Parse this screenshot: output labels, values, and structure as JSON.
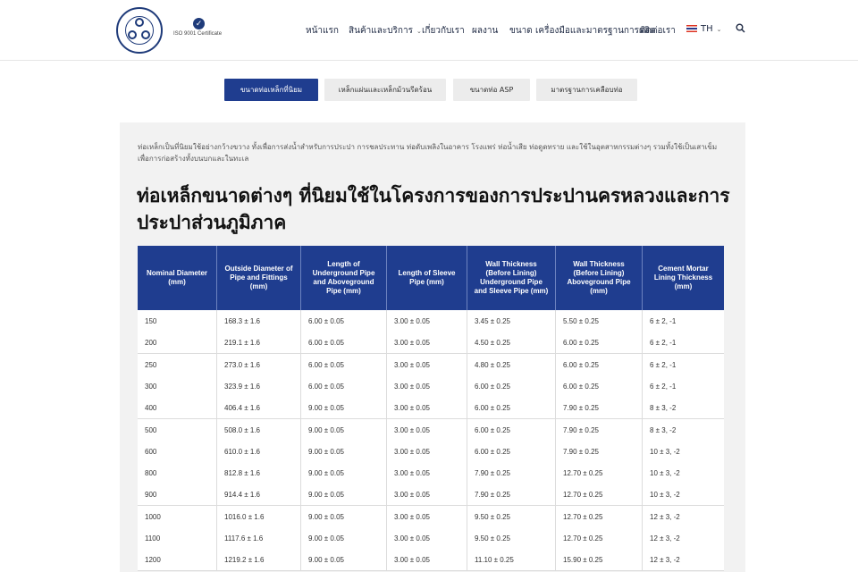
{
  "header": {
    "iso_text": "ISO 9001 Certificate",
    "nav": [
      {
        "label": "หน้าแรก",
        "dropdown": false
      },
      {
        "label": "สินค้าและบริการ",
        "dropdown": true
      },
      {
        "label": "เกี่ยวกับเรา",
        "dropdown": false
      },
      {
        "label": "ผลงาน",
        "dropdown": false
      },
      {
        "label": "ขนาด เครื่องมือและมาตรฐานการผลิต",
        "dropdown": false
      },
      {
        "label": "ติดต่อเรา",
        "dropdown": false
      }
    ],
    "language": "TH",
    "brand_color": "#1f3d8f"
  },
  "tabs": [
    {
      "label": "ขนาดท่อเหล็กที่นิยม",
      "active": true
    },
    {
      "label": "เหล็กแผ่นและเหล็กม้วนรีดร้อน",
      "active": false
    },
    {
      "label": "ขนาดท่อ ASP",
      "active": false
    },
    {
      "label": "มาตรฐานการเคลือบท่อ",
      "active": false
    }
  ],
  "content": {
    "intro": "ท่อเหล็กเป็นที่นิยมใช้อย่างกว้างขวาง ทั้งเพื่อการส่งน้ำสำหรับการประปา การชลประทาน ท่อดับเพลิงในอาคาร โรงแพร่ ท่อน้ำเสีย ท่อดูดทราย และใช้ในอุตสาหกรรมต่างๆ รวมทั้งใช้เป็นเสาเข็มเพื่อการก่อสร้างทั้งบนบกและในทะเล",
    "title": "ท่อเหล็กขนาดต่างๆ ที่นิยมใช้ในโครงการของการประปานครหลวงและการประปาส่วนภูมิภาค"
  },
  "table": {
    "headers": [
      "Nominal Diameter (mm)",
      "Outside Diameter of Pipe and Fittings (mm)",
      "Length of Underground Pipe and Aboveground Pipe (mm)",
      "Length of Sleeve Pipe (mm)",
      "Wall Thickness (Before Lining) Underground Pipe and Sleeve Pipe (mm)",
      "Wall Thickness (Before Lining) Aboveground Pipe (mm)",
      "Cement Mortar Lining Thickness (mm)"
    ],
    "rows": [
      [
        "150",
        "168.3 ± 1.6",
        "6.00 ± 0.05",
        "3.00 ± 0.05",
        "3.45 ± 0.25",
        "5.50 ± 0.25",
        "6 ± 2, -1"
      ],
      [
        "200",
        "219.1 ± 1.6",
        "6.00 ± 0.05",
        "3.00 ± 0.05",
        "4.50 ± 0.25",
        "6.00 ± 0.25",
        "6 ± 2, -1"
      ],
      [
        "250",
        "273.0 ± 1.6",
        "6.00 ± 0.05",
        "3.00 ± 0.05",
        "4.80 ± 0.25",
        "6.00 ± 0.25",
        "6 ± 2, -1"
      ],
      [
        "300",
        "323.9 ± 1.6",
        "6.00 ± 0.05",
        "3.00 ± 0.05",
        "6.00 ± 0.25",
        "6.00 ± 0.25",
        "6 ± 2, -1"
      ],
      [
        "400",
        "406.4 ± 1.6",
        "9.00 ± 0.05",
        "3.00 ± 0.05",
        "6.00 ± 0.25",
        "7.90 ± 0.25",
        "8 ± 3, -2"
      ],
      [
        "500",
        "508.0 ± 1.6",
        "9.00 ± 0.05",
        "3.00 ± 0.05",
        "6.00 ± 0.25",
        "7.90 ± 0.25",
        "8 ± 3, -2"
      ],
      [
        "600",
        "610.0 ± 1.6",
        "9.00 ± 0.05",
        "3.00 ± 0.05",
        "6.00 ± 0.25",
        "7.90 ± 0.25",
        "10 ± 3, -2"
      ],
      [
        "800",
        "812.8 ± 1.6",
        "9.00 ± 0.05",
        "3.00 ± 0.05",
        "7.90 ± 0.25",
        "12.70 ± 0.25",
        "10 ± 3, -2"
      ],
      [
        "900",
        "914.4 ± 1.6",
        "9.00 ± 0.05",
        "3.00 ± 0.05",
        "7.90 ± 0.25",
        "12.70 ± 0.25",
        "10 ± 3, -2"
      ],
      [
        "1000",
        "1016.0 ± 1.6",
        "9.00 ± 0.05",
        "3.00 ± 0.05",
        "9.50 ± 0.25",
        "12.70 ± 0.25",
        "12 ± 3, -2"
      ],
      [
        "1100",
        "1117.6 ± 1.6",
        "9.00 ± 0.05",
        "3.00 ± 0.05",
        "9.50 ± 0.25",
        "12.70 ± 0.25",
        "12 ± 3, -2"
      ],
      [
        "1200",
        "1219.2 ± 1.6",
        "9.00 ± 0.05",
        "3.00 ± 0.05",
        "11.10 ± 0.25",
        "15.90 ± 0.25",
        "12 ± 3, -2"
      ]
    ]
  }
}
